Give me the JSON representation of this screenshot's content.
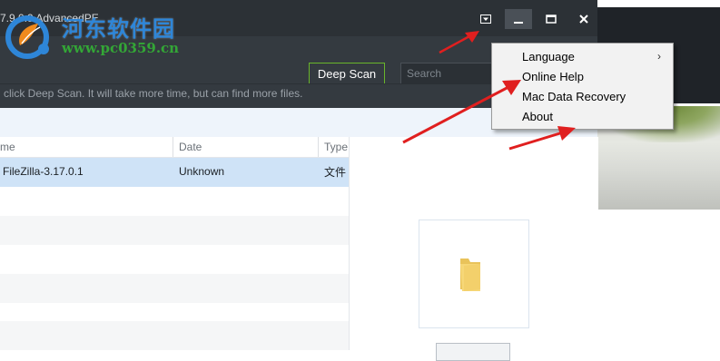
{
  "window": {
    "title_fragment": "7.9.0.9 AdvancedPE",
    "controls": {
      "dropdown_icon": "dropdown-arrow-icon",
      "minimize_icon": "minimize-icon",
      "maximize_icon": "maximize-icon",
      "close_icon": "close-icon"
    }
  },
  "toolbar": {
    "deep_scan_label": "Deep Scan",
    "search_placeholder": "Search"
  },
  "hint": {
    "text": "click Deep Scan. It will take more time, but can find more files."
  },
  "table": {
    "columns": [
      "me",
      "Date",
      "Type"
    ],
    "rows": [
      {
        "name": "FileZilla-3.17.0.1",
        "date": "Unknown",
        "type": "文件"
      }
    ]
  },
  "menu": {
    "items": [
      {
        "label": "Language",
        "has_submenu": true
      },
      {
        "label": "Online Help"
      },
      {
        "label": "Mac Data Recovery"
      },
      {
        "label": "About"
      }
    ],
    "submenu_icon": "chevron-right-icon"
  },
  "watermark": {
    "title": "河东软件园",
    "url": "www.pc0359.cn"
  },
  "colors": {
    "titlebar": "#2c3136",
    "toolbar": "#343a40",
    "deep_scan_border": "#69b52b",
    "selected_row": "#cfe3f7",
    "arrow": "#e01f1f",
    "watermark_blue": "#2e86d8",
    "watermark_green": "#33a636"
  }
}
